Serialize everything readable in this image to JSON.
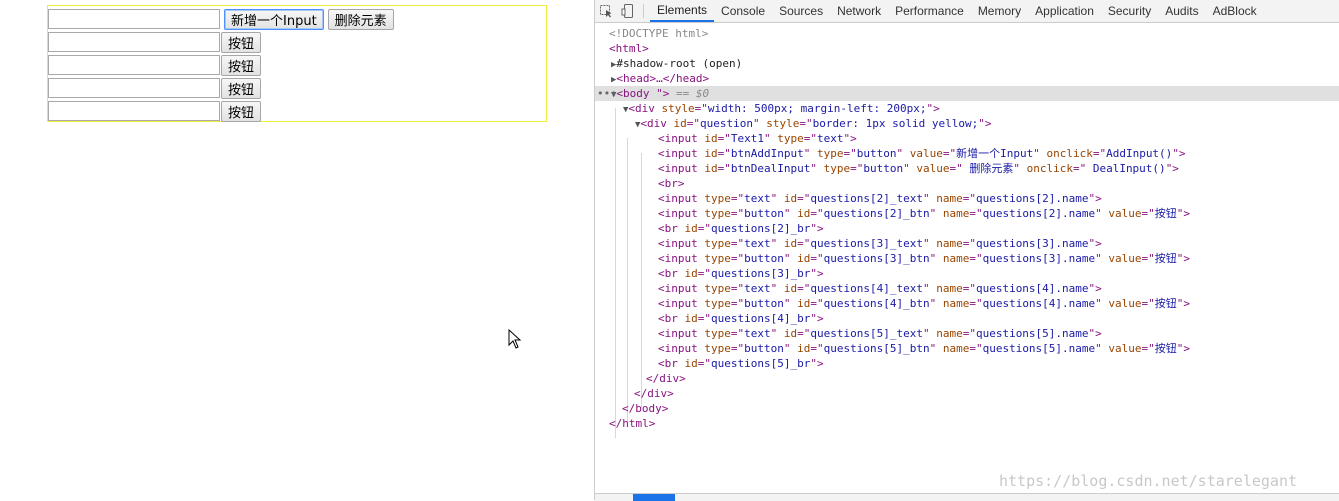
{
  "page": {
    "add_button": "新增一个Input",
    "delete_button": "删除元素",
    "rows": [
      {
        "button": "按钮"
      },
      {
        "button": "按钮"
      },
      {
        "button": "按钮"
      },
      {
        "button": "按钮"
      }
    ]
  },
  "devtools": {
    "tabs": [
      "Elements",
      "Console",
      "Sources",
      "Network",
      "Performance",
      "Memory",
      "Application",
      "Security",
      "Audits",
      "AdBlock"
    ],
    "active_tab": "Elements",
    "dom": {
      "doctype": "<!DOCTYPE html>",
      "html_open": "<html>",
      "shadow_root": "#shadow-root (open)",
      "head": "<head>…</head>",
      "body_tag": "<body \">",
      "body_eq": " == $0",
      "div_outer": {
        "tag": "div",
        "attr": "style",
        "value": "width: 500px; margin-left: 200px;"
      },
      "div_question": {
        "tag": "div",
        "attr1": "id",
        "val1": "question",
        "attr2": "style",
        "val2": "border: 1px solid yellow;"
      },
      "input_text1": {
        "id": "Text1",
        "type": "text"
      },
      "input_add": {
        "id": "btnAddInput",
        "type": "button",
        "value": "新增一个Input",
        "onclick": "AddInput()"
      },
      "input_del": {
        "id": "btnDealInput",
        "type": "button",
        "value": " 删除元素",
        "onclick": " DealInput()"
      },
      "br": "<br>",
      "groups": [
        {
          "text_id": "questions[2]_text",
          "name": "questions[2].name",
          "btn_id": "questions[2]_btn",
          "value": "按钮",
          "br_id": "questions[2]_br"
        },
        {
          "text_id": "questions[3]_text",
          "name": "questions[3].name",
          "btn_id": "questions[3]_btn",
          "value": "按钮",
          "br_id": "questions[3]_br"
        },
        {
          "text_id": "questions[4]_text",
          "name": "questions[4].name",
          "btn_id": "questions[4]_btn",
          "value": "按钮",
          "br_id": "questions[4]_br"
        },
        {
          "text_id": "questions[5]_text",
          "name": "questions[5].name",
          "btn_id": "questions[5]_btn",
          "value": "按钮",
          "br_id": "questions[5]_br"
        }
      ],
      "div_close": "</div>",
      "body_close": "</body>",
      "html_close": "</html>"
    },
    "watermark": "https://blog.csdn.net/starelegant"
  },
  "icons": {
    "inspect": "inspect-element-icon",
    "device": "device-toolbar-icon",
    "cursor": "mouse-cursor-icon"
  }
}
